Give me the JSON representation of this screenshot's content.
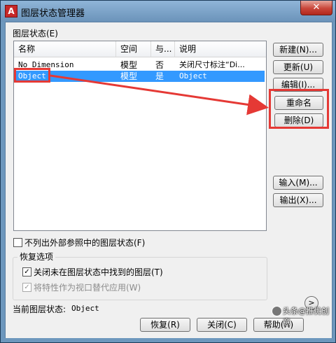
{
  "window": {
    "app_icon": "A",
    "title": "图层状态管理器",
    "close_label": "✕"
  },
  "states_label": "图层状态(E)",
  "table": {
    "headers": [
      "名称",
      "空间",
      "与...",
      "说明"
    ],
    "rows": [
      {
        "name": "No Dimension",
        "space": "模型",
        "same": "否",
        "desc": "关闭尺寸标注“Di..."
      },
      {
        "name": "Object",
        "space": "模型",
        "same": "是",
        "desc": "Object"
      }
    ]
  },
  "buttons": {
    "new": "新建(N)...",
    "update": "更新(U)",
    "edit": "编辑(I)...",
    "rename": "重命名",
    "delete": "删除(D)",
    "import": "输入(M)...",
    "export": "输出(X)...",
    "restore": "恢复(R)",
    "close": "关闭(C)",
    "help": "帮助(H)",
    "more": ">"
  },
  "options": {
    "exclude_xref_label": "不列出外部参照中的图层状态(F)",
    "exclude_xref_checked": false,
    "group_title": "恢复选项",
    "turn_off_label": "关闭未在图层状态中找到的图层(T)",
    "turn_off_checked": true,
    "apply_viewport_label": "将特性作为视口替代应用(W)",
    "apply_viewport_checked": true
  },
  "current_state": {
    "label": "当前图层状态:",
    "value": "Object"
  },
  "watermark": "头条@推优创意",
  "annotation": {
    "color": "#e53935"
  }
}
